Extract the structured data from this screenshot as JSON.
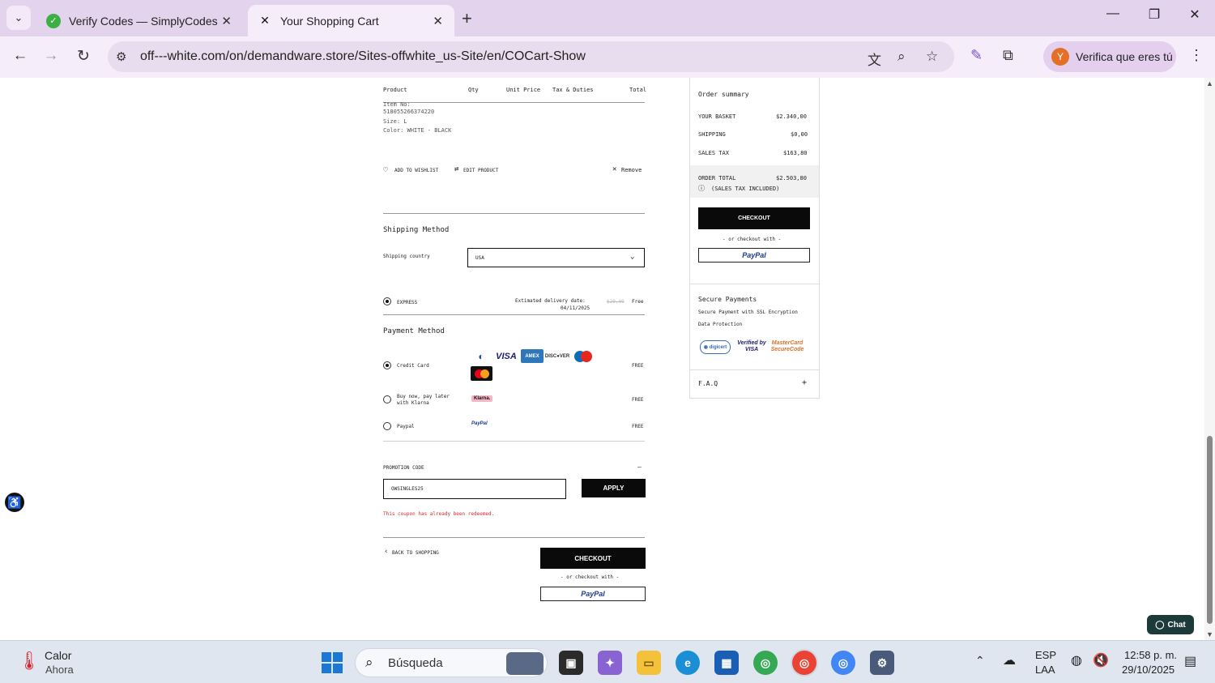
{
  "browser": {
    "tabs": [
      {
        "title": "Verify Codes — SimplyCodes",
        "active": false
      },
      {
        "title": "Your Shopping Cart",
        "active": true
      }
    ],
    "url": "off---white.com/on/demandware.store/Sites-offwhite_us-Site/en/COCart-Show",
    "profile_label": "Verifica que eres tú",
    "profile_initial": "Y"
  },
  "cart": {
    "headers": [
      "Product",
      "Qty",
      "Unit Price",
      "Tax & Duties",
      "Total"
    ],
    "item": {
      "item_no_label": "Item No:",
      "item_no": "518055266374220",
      "size": "Size: L",
      "color": "Color: WHITE - BLACK"
    },
    "actions": {
      "wishlist": "ADD TO WISHLIST",
      "edit": "EDIT PRODUCT",
      "remove": "Remove"
    }
  },
  "shipping": {
    "title": "Shipping Method",
    "country_label": "Shipping country",
    "country_value": "USA",
    "option_label": "EXPRESS",
    "delivery_label": "Extimated delivery date:",
    "delivery_date": "04/11/2025",
    "old_price": "$20,00",
    "price": "Free"
  },
  "payment": {
    "title": "Payment Method",
    "options": [
      {
        "label": "Credit Card",
        "fee": "FREE",
        "selected": true
      },
      {
        "label_line1": "Buy now, pay later",
        "label_line2": "with Klarna",
        "fee": "FREE",
        "selected": false
      },
      {
        "label": "Paypal",
        "fee": "FREE",
        "selected": false
      }
    ],
    "card_logos": [
      "diners-icon",
      "visa-icon",
      "amex-icon",
      "discover-icon",
      "maestro-icon",
      "mastercard-icon"
    ],
    "klarna_badge": "Klarna.",
    "paypal_badge": "PayPal"
  },
  "promo": {
    "label": "PROMOTION CODE",
    "toggle": "—",
    "value": "OWSINGLES25",
    "apply": "APPLY",
    "error": "This coupon has already been redeemed."
  },
  "bottom": {
    "back": "BACK TO SHOPPING",
    "checkout": "CHECKOUT",
    "or_checkout": "- or checkout with -",
    "paypal": "PayPal"
  },
  "summary": {
    "title": "Order summary",
    "rows": [
      {
        "label": "YOUR BASKET",
        "value": "$2.340,00"
      },
      {
        "label": "SHIPPING",
        "value": "$0,00"
      },
      {
        "label": "SALES TAX",
        "value": "$163,80"
      }
    ],
    "total_label": "ORDER TOTAL",
    "total_value": "$2.503,80",
    "tax_note": "(SALES TAX INCLUDED)",
    "checkout": "CHECKOUT",
    "or_checkout": "- or checkout with -",
    "paypal": "PayPal",
    "secure_title": "Secure Payments",
    "secure_line1": "Secure Payment with SSL Encryption",
    "secure_line2": "Data Protection",
    "faq": "F.A.Q",
    "faq_toggle": "+"
  },
  "chat": "Chat",
  "taskbar": {
    "weather_title": "Calor",
    "weather_sub": "Ahora",
    "search_placeholder": "Búsqueda",
    "lang_top": "ESP",
    "lang_bottom": "LAA",
    "time": "12:58 p. m.",
    "date": "29/10/2025"
  }
}
